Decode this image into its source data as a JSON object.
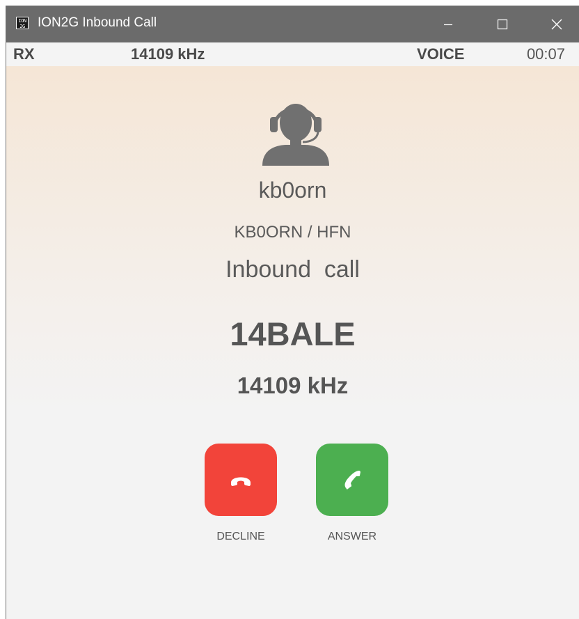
{
  "window": {
    "title": "ION2G Inbound Call",
    "app_icon_text": "ION 2G"
  },
  "status": {
    "rx": "RX",
    "frequency": "14109 kHz",
    "mode": "VOICE",
    "timer": "00:07"
  },
  "caller": {
    "name": "kb0orn",
    "id": "KB0ORN / HFN",
    "state": "Inbound  call",
    "avatar_icon": "headset-person-icon"
  },
  "call": {
    "net": "14BALE",
    "frequency": "14109 kHz"
  },
  "actions": {
    "decline_label": "DECLINE",
    "answer_label": "ANSWER",
    "decline_color": "#f2443a",
    "answer_color": "#4caf50"
  },
  "colors": {
    "titlebar": "#6b6b6b",
    "gradient_top": "#f5e6d6",
    "background": "#f3f3f3",
    "text": "#5a5a5a"
  }
}
